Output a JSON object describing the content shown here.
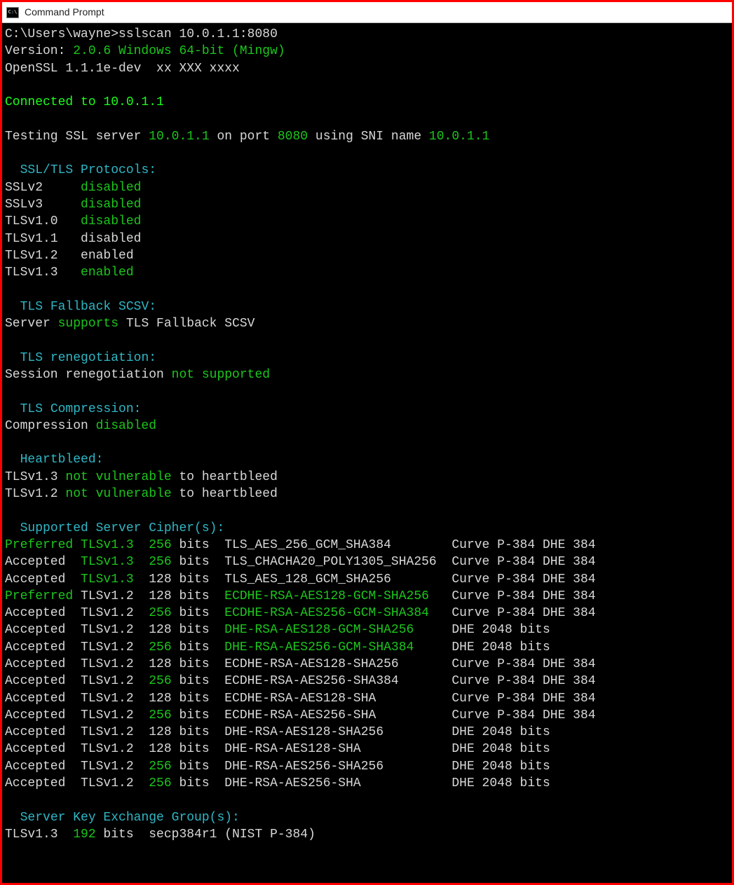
{
  "window": {
    "title": "Command Prompt"
  },
  "prompt": {
    "path": "C:\\Users\\wayne>",
    "command": "sslscan 10.0.1.1:8080"
  },
  "version": {
    "label": "Version:",
    "value": "2.0.6 Windows 64-bit (Mingw)"
  },
  "openssl": "OpenSSL 1.1.1e-dev  xx XXX xxxx",
  "connected": {
    "label": "Connected to",
    "host": "10.0.1.1"
  },
  "testing": {
    "p1": "Testing SSL server ",
    "host": "10.0.1.1",
    "p2": " on port ",
    "port": "8080",
    "p3": " using SNI name ",
    "sni": "10.0.1.1"
  },
  "sections": {
    "protocols": "SSL/TLS Protocols:",
    "fallback": "TLS Fallback SCSV:",
    "reneg": "TLS renegotiation:",
    "comp": "TLS Compression:",
    "heartbleed": "Heartbleed:",
    "ciphers": "Supported Server Cipher(s):",
    "kex": "Server Key Exchange Group(s):"
  },
  "protocols": [
    {
      "name": "SSLv2",
      "status": "disabled",
      "color": "green"
    },
    {
      "name": "SSLv3",
      "status": "disabled",
      "color": "green"
    },
    {
      "name": "TLSv1.0",
      "status": "disabled",
      "color": "green"
    },
    {
      "name": "TLSv1.1",
      "status": "disabled",
      "color": "white"
    },
    {
      "name": "TLSv1.2",
      "status": "enabled",
      "color": "white"
    },
    {
      "name": "TLSv1.3",
      "status": "enabled",
      "color": "green"
    }
  ],
  "fallback": {
    "p1": "Server ",
    "status": "supports",
    "p2": " TLS Fallback SCSV"
  },
  "reneg": {
    "p1": "Session renegotiation ",
    "status": "not supported"
  },
  "comp": {
    "p1": "Compression ",
    "status": "disabled"
  },
  "heartbleed": [
    {
      "proto": "TLSv1.3",
      "status": "not vulnerable",
      "suffix": " to heartbleed"
    },
    {
      "proto": "TLSv1.2",
      "status": "not vulnerable",
      "suffix": " to heartbleed"
    }
  ],
  "ciphers": [
    {
      "status": "Preferred",
      "scolor": "green",
      "tls": "TLSv1.3",
      "tlscolor": "green",
      "bits": "256",
      "bitscolor": "green",
      "cipher": "TLS_AES_256_GCM_SHA384",
      "ccolor": "white",
      "info": "Curve P-384 DHE 384"
    },
    {
      "status": "Accepted",
      "scolor": "white",
      "tls": "TLSv1.3",
      "tlscolor": "green",
      "bits": "256",
      "bitscolor": "green",
      "cipher": "TLS_CHACHA20_POLY1305_SHA256",
      "ccolor": "white",
      "info": "Curve P-384 DHE 384"
    },
    {
      "status": "Accepted",
      "scolor": "white",
      "tls": "TLSv1.3",
      "tlscolor": "green",
      "bits": "128",
      "bitscolor": "white",
      "cipher": "TLS_AES_128_GCM_SHA256",
      "ccolor": "white",
      "info": "Curve P-384 DHE 384"
    },
    {
      "status": "Preferred",
      "scolor": "green",
      "tls": "TLSv1.2",
      "tlscolor": "white",
      "bits": "128",
      "bitscolor": "white",
      "cipher": "ECDHE-RSA-AES128-GCM-SHA256",
      "ccolor": "green",
      "info": "Curve P-384 DHE 384"
    },
    {
      "status": "Accepted",
      "scolor": "white",
      "tls": "TLSv1.2",
      "tlscolor": "white",
      "bits": "256",
      "bitscolor": "green",
      "cipher": "ECDHE-RSA-AES256-GCM-SHA384",
      "ccolor": "green",
      "info": "Curve P-384 DHE 384"
    },
    {
      "status": "Accepted",
      "scolor": "white",
      "tls": "TLSv1.2",
      "tlscolor": "white",
      "bits": "128",
      "bitscolor": "white",
      "cipher": "DHE-RSA-AES128-GCM-SHA256",
      "ccolor": "green",
      "info": "DHE 2048 bits"
    },
    {
      "status": "Accepted",
      "scolor": "white",
      "tls": "TLSv1.2",
      "tlscolor": "white",
      "bits": "256",
      "bitscolor": "green",
      "cipher": "DHE-RSA-AES256-GCM-SHA384",
      "ccolor": "green",
      "info": "DHE 2048 bits"
    },
    {
      "status": "Accepted",
      "scolor": "white",
      "tls": "TLSv1.2",
      "tlscolor": "white",
      "bits": "128",
      "bitscolor": "white",
      "cipher": "ECDHE-RSA-AES128-SHA256",
      "ccolor": "white",
      "info": "Curve P-384 DHE 384"
    },
    {
      "status": "Accepted",
      "scolor": "white",
      "tls": "TLSv1.2",
      "tlscolor": "white",
      "bits": "256",
      "bitscolor": "green",
      "cipher": "ECDHE-RSA-AES256-SHA384",
      "ccolor": "white",
      "info": "Curve P-384 DHE 384"
    },
    {
      "status": "Accepted",
      "scolor": "white",
      "tls": "TLSv1.2",
      "tlscolor": "white",
      "bits": "128",
      "bitscolor": "white",
      "cipher": "ECDHE-RSA-AES128-SHA",
      "ccolor": "white",
      "info": "Curve P-384 DHE 384"
    },
    {
      "status": "Accepted",
      "scolor": "white",
      "tls": "TLSv1.2",
      "tlscolor": "white",
      "bits": "256",
      "bitscolor": "green",
      "cipher": "ECDHE-RSA-AES256-SHA",
      "ccolor": "white",
      "info": "Curve P-384 DHE 384"
    },
    {
      "status": "Accepted",
      "scolor": "white",
      "tls": "TLSv1.2",
      "tlscolor": "white",
      "bits": "128",
      "bitscolor": "white",
      "cipher": "DHE-RSA-AES128-SHA256",
      "ccolor": "white",
      "info": "DHE 2048 bits"
    },
    {
      "status": "Accepted",
      "scolor": "white",
      "tls": "TLSv1.2",
      "tlscolor": "white",
      "bits": "128",
      "bitscolor": "white",
      "cipher": "DHE-RSA-AES128-SHA",
      "ccolor": "white",
      "info": "DHE 2048 bits"
    },
    {
      "status": "Accepted",
      "scolor": "white",
      "tls": "TLSv1.2",
      "tlscolor": "white",
      "bits": "256",
      "bitscolor": "green",
      "cipher": "DHE-RSA-AES256-SHA256",
      "ccolor": "white",
      "info": "DHE 2048 bits"
    },
    {
      "status": "Accepted",
      "scolor": "white",
      "tls": "TLSv1.2",
      "tlscolor": "white",
      "bits": "256",
      "bitscolor": "green",
      "cipher": "DHE-RSA-AES256-SHA",
      "ccolor": "white",
      "info": "DHE 2048 bits"
    }
  ],
  "bits_unit": "bits",
  "kex": {
    "proto": "TLSv1.3",
    "bits": "192",
    "bits_unit": "bits",
    "group": "secp384r1 (NIST P-384)"
  }
}
